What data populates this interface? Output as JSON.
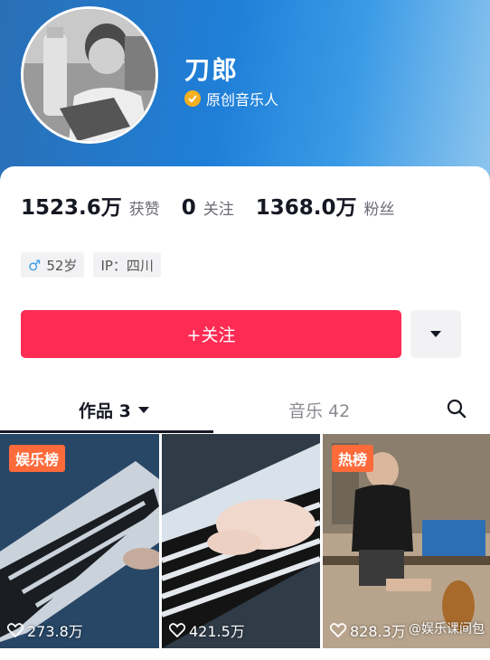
{
  "profile": {
    "name": "刀郎",
    "verify_label": "原创音乐人"
  },
  "stats": [
    {
      "value": "1523.6万",
      "label": "获赞"
    },
    {
      "value": "0",
      "label": "关注"
    },
    {
      "value": "1368.0万",
      "label": "粉丝"
    }
  ],
  "tags": {
    "age": "52岁",
    "ip": "IP：四川"
  },
  "follow_button": "+关注",
  "tabs": {
    "works": "作品 3",
    "music": "音乐 42"
  },
  "videos": [
    {
      "badge": "娱乐榜",
      "likes": "273.8万"
    },
    {
      "badge": "",
      "likes": "421.5万"
    },
    {
      "badge": "热榜",
      "likes": "828.3万"
    }
  ],
  "watermark": "@娱乐课间包",
  "colors": {
    "accent": "#fe2c55",
    "verify": "#f5b021",
    "badge": "#fe6a3a"
  }
}
